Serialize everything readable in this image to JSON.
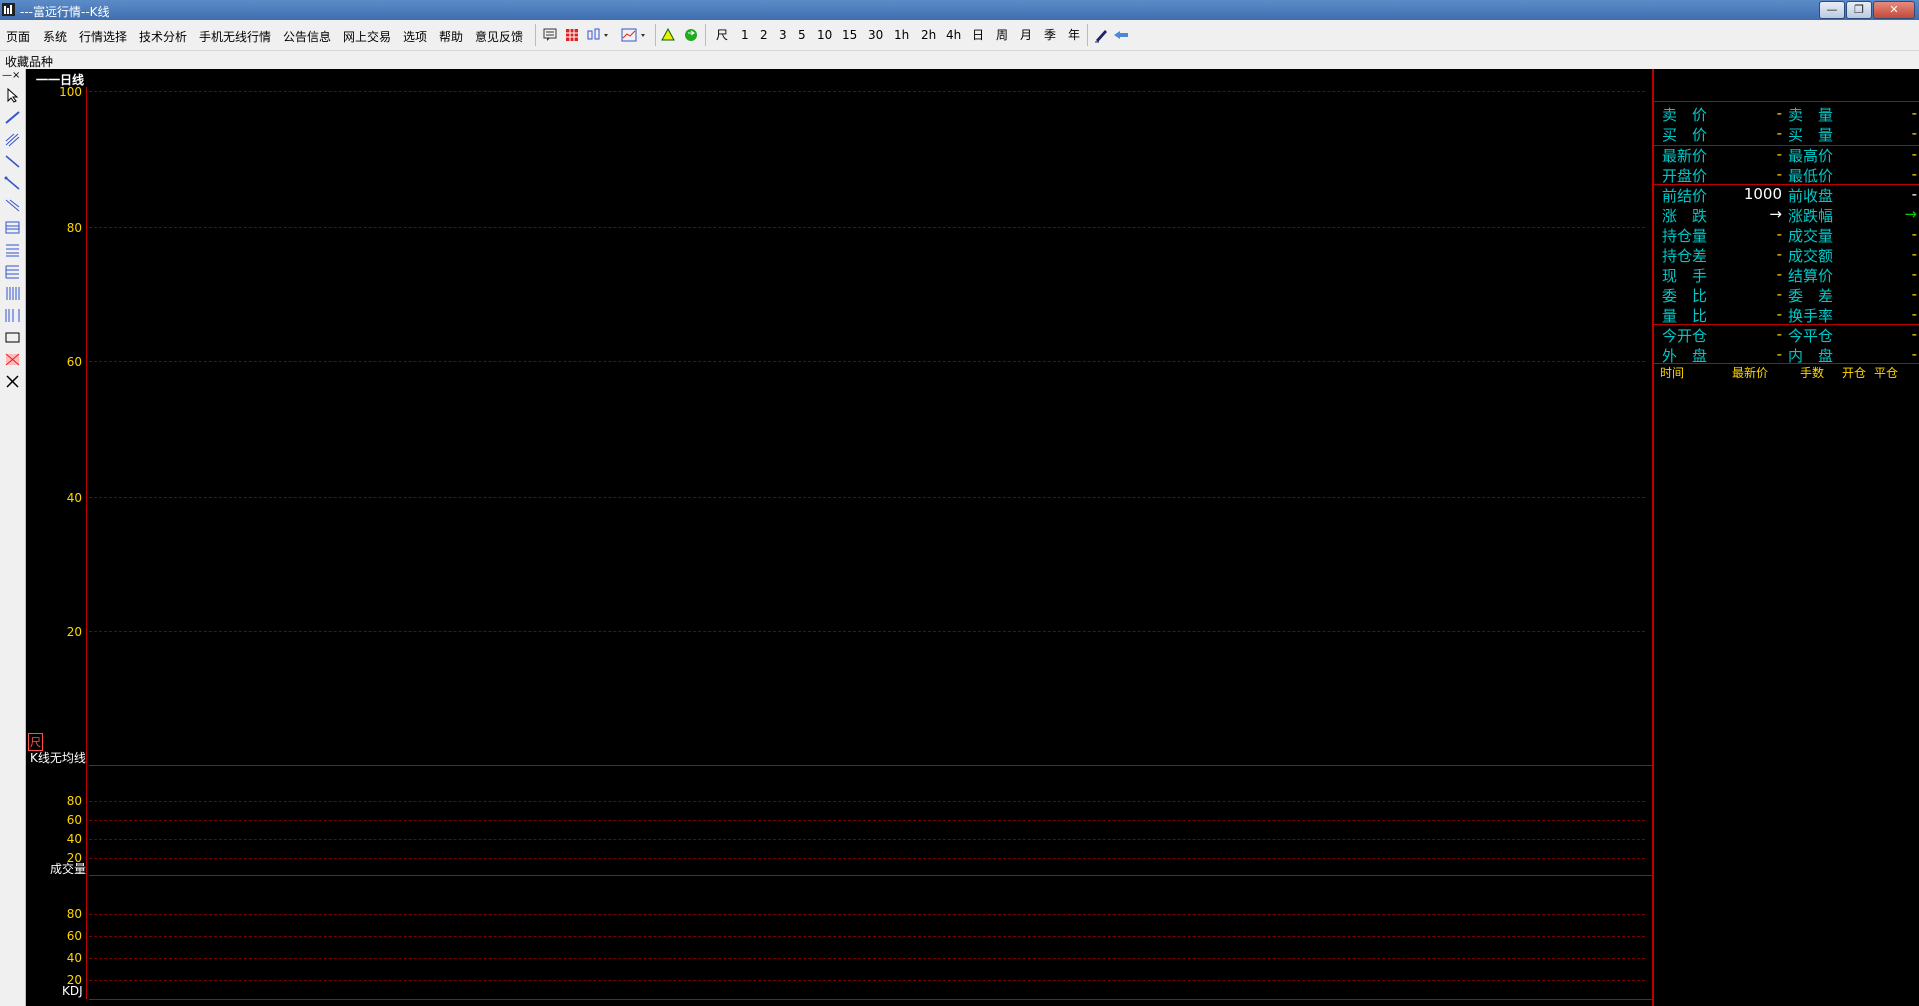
{
  "window": {
    "title": "---富远行情--K线"
  },
  "menu": [
    "页面",
    "系统",
    "行情选择",
    "技术分析",
    "手机无线行情",
    "公告信息",
    "网上交易",
    "选项",
    "帮助",
    "意见反馈"
  ],
  "toolbar": {
    "periods": [
      "尺",
      "1",
      "2",
      "3",
      "5",
      "10",
      "15",
      "30",
      "1h",
      "2h",
      "4h",
      "日",
      "周",
      "月",
      "季",
      "年"
    ]
  },
  "favorites_label": "收藏品种",
  "chart": {
    "period_label": "一一日线",
    "main_ticks": [
      "100",
      "80",
      "60",
      "40",
      "20"
    ],
    "main_indicator": "K线无均线",
    "ruler_mark": "尺",
    "volume_label": "成交量",
    "volume_ticks": [
      "80",
      "60",
      "40",
      "20"
    ],
    "kdj_label": "KDJ",
    "kdj_ticks": [
      "80",
      "60",
      "40",
      "20"
    ]
  },
  "quote": {
    "rows": [
      {
        "l1": "卖　价",
        "v1": "-",
        "l2": "卖　量",
        "v2": "-"
      },
      {
        "l1": "买　价",
        "v1": "-",
        "l2": "买　量",
        "v2": "-"
      },
      {
        "l1": "最新价",
        "v1": "-",
        "l2": "最高价",
        "v2": "-"
      },
      {
        "l1": "开盘价",
        "v1": "-",
        "l2": "最低价",
        "v2": "-"
      },
      {
        "l1": "前结价",
        "v1": "1000",
        "l2": "前收盘",
        "v2": "-"
      },
      {
        "l1": "涨　跌",
        "v1": "→",
        "l2": "涨跌幅",
        "v2": "→"
      },
      {
        "l1": "持仓量",
        "v1": "-",
        "l2": "成交量",
        "v2": "-"
      },
      {
        "l1": "持仓差",
        "v1": "-",
        "l2": "成交额",
        "v2": "-"
      },
      {
        "l1": "现　手",
        "v1": "-",
        "l2": "结算价",
        "v2": "-"
      },
      {
        "l1": "委　比",
        "v1": "-",
        "l2": "委　差",
        "v2": "-"
      },
      {
        "l1": "量　比",
        "v1": "-",
        "l2": "换手率",
        "v2": "-"
      },
      {
        "l1": "今开仓",
        "v1": "-",
        "l2": "今平仓",
        "v2": "-"
      },
      {
        "l1": "外　盘",
        "v1": "-",
        "l2": "内　盘",
        "v2": "-"
      }
    ],
    "tick_headers": [
      "时间",
      "最新价",
      "手数",
      "开仓",
      "平仓"
    ]
  },
  "colors": {
    "grid": "#7a0000",
    "border": "#c00000",
    "label": "#00c8c8",
    "axis": "#ffd700"
  }
}
